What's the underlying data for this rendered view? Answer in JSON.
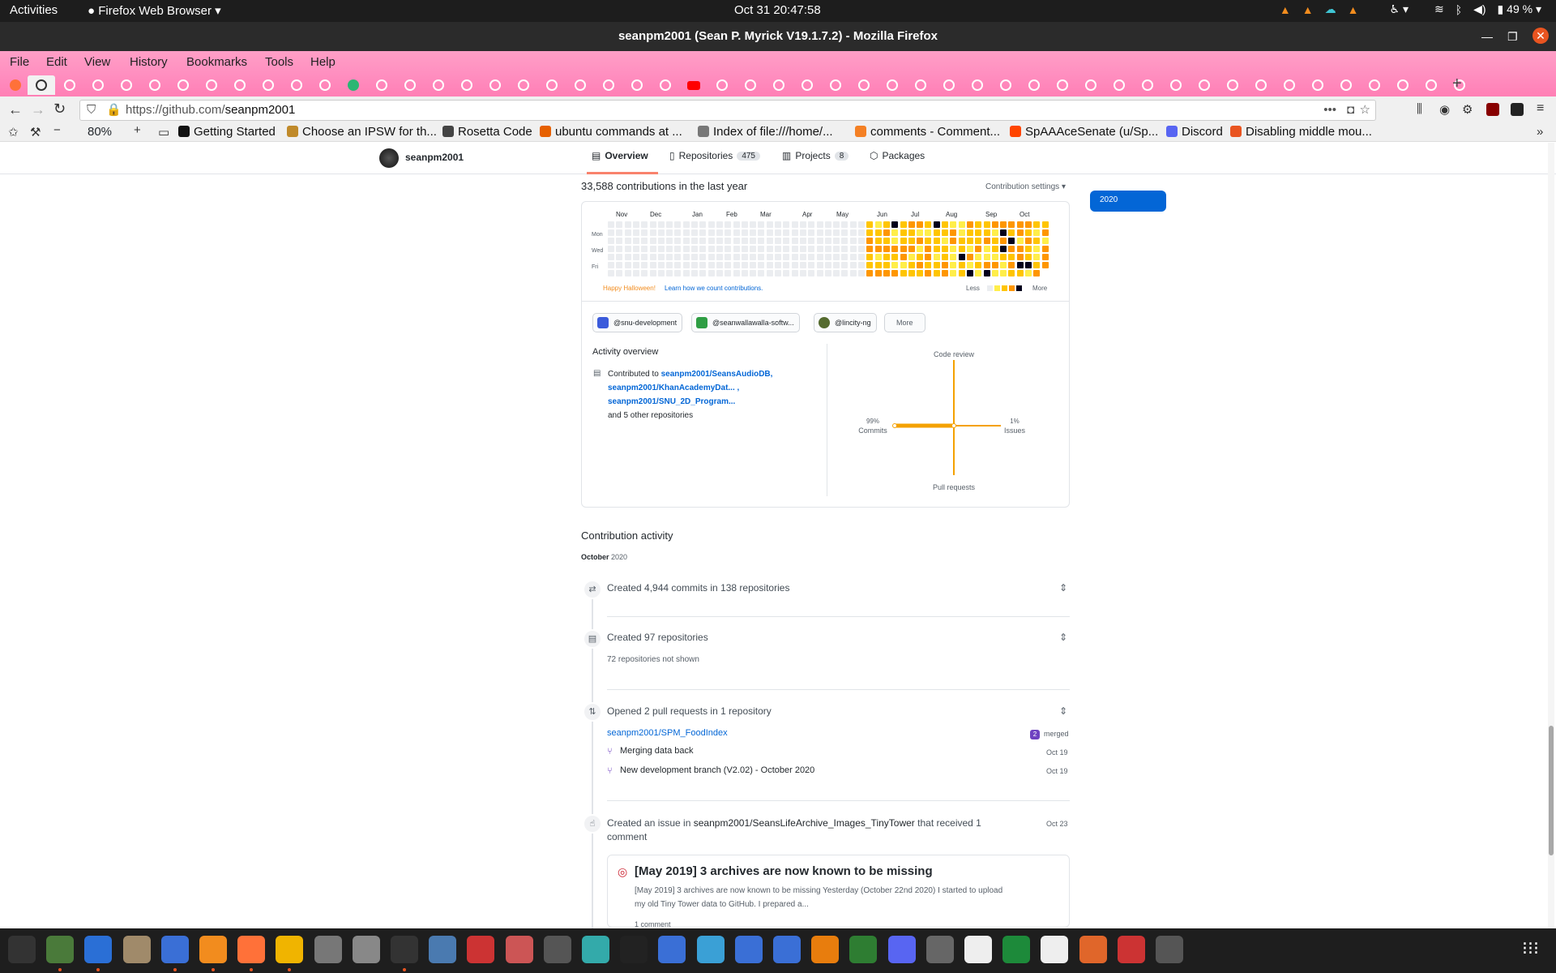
{
  "system": {
    "activities": "Activities",
    "app_menu": "Firefox Web Browser",
    "clock": "Oct 31  20:47:58",
    "battery": "49 %"
  },
  "window": {
    "title": "seanpm2001 (Sean P. Myrick V19.1.7.2) - Mozilla Firefox"
  },
  "menu": [
    "File",
    "Edit",
    "View",
    "History",
    "Bookmarks",
    "Tools",
    "Help"
  ],
  "navbar": {
    "url_prefix": "https://github.com/",
    "url_rest": "seanpm2001",
    "zoom": "80%"
  },
  "bookmarks": [
    {
      "label": "Getting Started",
      "color": "#111111"
    },
    {
      "label": "Choose an IPSW for th...",
      "color": "#c08a2a"
    },
    {
      "label": "Rosetta Code",
      "color": "#444444"
    },
    {
      "label": "ubuntu commands at ...",
      "color": "#e66000"
    },
    {
      "label": "Index of file:///home/...",
      "color": "#777777"
    },
    {
      "label": "comments - Comment...",
      "color": "#f48024"
    },
    {
      "label": "SpAAAceSenate (u/Sp...",
      "color": "#ff4500"
    },
    {
      "label": "Discord",
      "color": "#5865f2"
    },
    {
      "label": "Disabling middle mou...",
      "color": "#e95420"
    }
  ],
  "profile_nav": {
    "username": "seanpm2001",
    "tabs": [
      {
        "label": "Overview",
        "count": ""
      },
      {
        "label": "Repositories",
        "count": "475"
      },
      {
        "label": "Projects",
        "count": "8"
      },
      {
        "label": "Packages",
        "count": ""
      }
    ]
  },
  "contributions": {
    "headline": "33,588 contributions in the last year",
    "settings": "Contribution settings",
    "year": "2020",
    "months": [
      "Nov",
      "Dec",
      "Jan",
      "Feb",
      "Mar",
      "Apr",
      "May",
      "Jun",
      "Jul",
      "Aug",
      "Sep",
      "Oct"
    ],
    "days": [
      "Mon",
      "Wed",
      "Fri"
    ],
    "halloween": "Happy Halloween!",
    "learn": "Learn how we count contributions.",
    "less": "Less",
    "more": "More",
    "active_from_week": 31,
    "colors": {
      "empty": "#ebedf0",
      "l1": "#ffee4a",
      "l2": "#ffc501",
      "l3": "#fe9600",
      "l4": "#03001c"
    }
  },
  "orgs": [
    "@snu-development",
    "@seanwallawalla-softw...",
    "@lincity-ng",
    "More"
  ],
  "activity_overview": {
    "title": "Activity overview",
    "contributed_to": "Contributed to",
    "repos": [
      "seanpm2001/SeansAudioDB,",
      "seanpm2001/KhanAcademyDat... ,",
      "seanpm2001/SNU_2D_Program..."
    ],
    "others": "and 5 other repositories",
    "axes": {
      "code_review": "Code review",
      "commits_pct": "99%",
      "commits": "Commits",
      "issues_pct": "1%",
      "issues": "Issues",
      "pull_requests": "Pull requests"
    }
  },
  "activity": {
    "title": "Contribution activity",
    "month": "October",
    "year": "2020",
    "commits": "Created 4,944 commits in 138 repositories",
    "created_repos": "Created 97 repositories",
    "not_shown": "72 repositories not shown",
    "opened_prs": "Opened 2 pull requests in 1 repository",
    "pr_repo": "seanpm2001/SPM_FoodIndex",
    "merged_count": "2",
    "merged": "merged",
    "prs": [
      {
        "title": "Merging data back",
        "date": "Oct 19"
      },
      {
        "title": "New development branch (V2.02) - October 2020",
        "date": "Oct 19"
      }
    ],
    "issue_prefix": "Created an issue in",
    "issue_repo": "seanpm2001/SeansLifeArchive_Images_TinyTower",
    "issue_suffix": "that received 1",
    "issue_suffix2": "comment",
    "issue_date": "Oct 23",
    "issue_title": "[May 2019] 3 archives are now known to be missing",
    "issue_body1": "[May 2019] 3 archives are now known to be missing Yesterday (October 22nd 2020) I started to upload",
    "issue_body2": "my old Tiny Tower data to GitHub. I prepared a...",
    "issue_comments": "1 comment"
  }
}
